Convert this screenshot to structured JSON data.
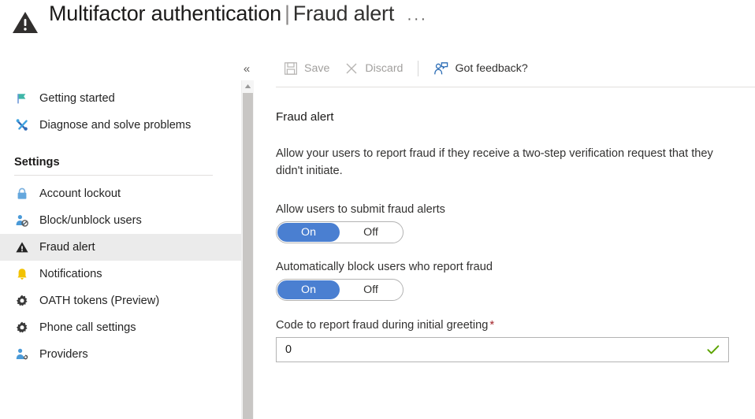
{
  "header": {
    "icon": "warning-triangle-icon",
    "resource_title": "Multifactor authentication",
    "separator": "|",
    "blade_title": "Fraud alert",
    "ellipsis": "···"
  },
  "sidebar": {
    "collapse_label": "«",
    "top_items": [
      {
        "label": "Getting started",
        "icon": "flag-icon",
        "selected": false
      },
      {
        "label": "Diagnose and solve problems",
        "icon": "wrench-screwdriver-icon",
        "selected": false
      }
    ],
    "section_heading": "Settings",
    "settings_items": [
      {
        "label": "Account lockout",
        "icon": "lock-icon",
        "selected": false
      },
      {
        "label": "Block/unblock users",
        "icon": "user-block-icon",
        "selected": false
      },
      {
        "label": "Fraud alert",
        "icon": "warning-triangle-icon",
        "selected": true
      },
      {
        "label": "Notifications",
        "icon": "bell-icon",
        "selected": false
      },
      {
        "label": "OATH tokens (Preview)",
        "icon": "gear-icon",
        "selected": false
      },
      {
        "label": "Phone call settings",
        "icon": "gear-icon",
        "selected": false
      },
      {
        "label": "Providers",
        "icon": "user-gear-icon",
        "selected": false
      }
    ]
  },
  "toolbar": {
    "save_label": "Save",
    "discard_label": "Discard",
    "feedback_label": "Got feedback?"
  },
  "main": {
    "section_title": "Fraud alert",
    "description": "Allow your users to report fraud if they receive a two-step verification request that they didn't initiate.",
    "toggle_allow": {
      "label": "Allow users to submit fraud alerts",
      "on_label": "On",
      "off_label": "Off",
      "value": "On"
    },
    "toggle_block": {
      "label": "Automatically block users who report fraud",
      "on_label": "On",
      "off_label": "Off",
      "value": "On"
    },
    "code_field": {
      "label": "Code to report fraud during initial greeting",
      "required_marker": "*",
      "value": "0",
      "placeholder": "",
      "validation_icon": "check-icon"
    }
  },
  "colors": {
    "accent_blue": "#4a7fd1",
    "selected_row": "#ebebeb",
    "required_red": "#a4262c",
    "valid_green": "#5ba300",
    "disabled_text": "#a19f9d"
  }
}
